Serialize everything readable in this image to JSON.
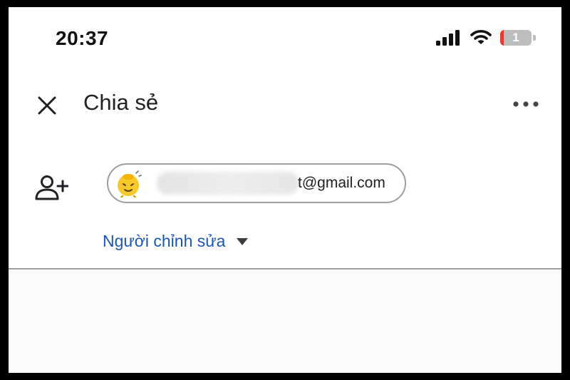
{
  "status_bar": {
    "time": "20:37",
    "battery_level": "1",
    "battery_fraction": 0.12
  },
  "header": {
    "title": "Chia sẻ",
    "close_icon": "close-icon",
    "menu_icon": "more-horizontal-icon"
  },
  "recipient": {
    "add_icon": "add-person-icon",
    "email_visible_suffix": "t@gmail.com"
  },
  "role": {
    "label": "Người chỉnh sửa",
    "icon": "caret-down-icon"
  },
  "colors": {
    "link_blue": "#1a56b8",
    "battery_low": "#e53935",
    "border_gray": "#9e9e9e"
  }
}
